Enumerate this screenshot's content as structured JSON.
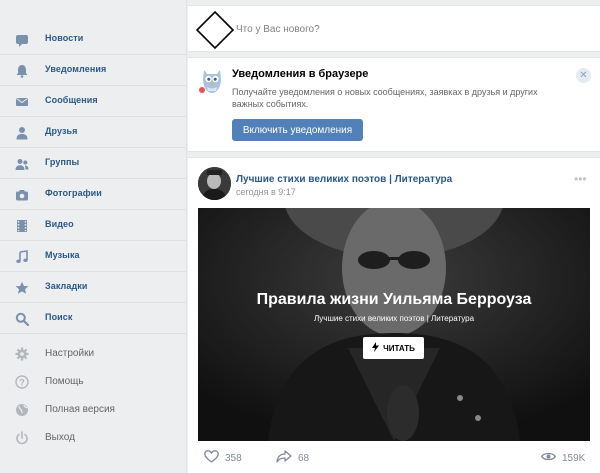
{
  "sidebar": {
    "items": [
      {
        "label": "Новости",
        "icon": "news-icon"
      },
      {
        "label": "Уведомления",
        "icon": "bell-icon"
      },
      {
        "label": "Сообщения",
        "icon": "message-icon"
      },
      {
        "label": "Друзья",
        "icon": "person-icon"
      },
      {
        "label": "Группы",
        "icon": "group-icon"
      },
      {
        "label": "Фотографии",
        "icon": "camera-icon"
      },
      {
        "label": "Видео",
        "icon": "film-icon"
      },
      {
        "label": "Музыка",
        "icon": "music-note-icon"
      },
      {
        "label": "Закладки",
        "icon": "star-icon"
      },
      {
        "label": "Поиск",
        "icon": "search-icon"
      }
    ],
    "secondary": [
      {
        "label": "Настройки",
        "icon": "gear-icon"
      },
      {
        "label": "Помощь",
        "icon": "help-icon"
      },
      {
        "label": "Полная версия",
        "icon": "globe-icon"
      },
      {
        "label": "Выход",
        "icon": "power-icon"
      }
    ],
    "accent_color": "#2a5885",
    "icon_color": "#7a91ad"
  },
  "compose": {
    "placeholder": "Что у Вас нового?"
  },
  "notification": {
    "title": "Уведомления в браузере",
    "body": "Получайте уведомления о новых сообщениях, заявках в друзья и других важных событиях.",
    "button_label": "Включить уведомления",
    "close_symbol": "✕",
    "button_color": "#5181b8"
  },
  "post": {
    "author": "Лучшие стихи великих поэтов | Литература",
    "time": "сегодня в 9:17",
    "more": "•••",
    "article_title": "Правила жизни Уильяма Берроуза",
    "article_source": "Лучшие стихи великих поэтов | Литература",
    "read_label": "ЧИТАТЬ",
    "likes": "358",
    "shares": "68",
    "views": "159K"
  }
}
